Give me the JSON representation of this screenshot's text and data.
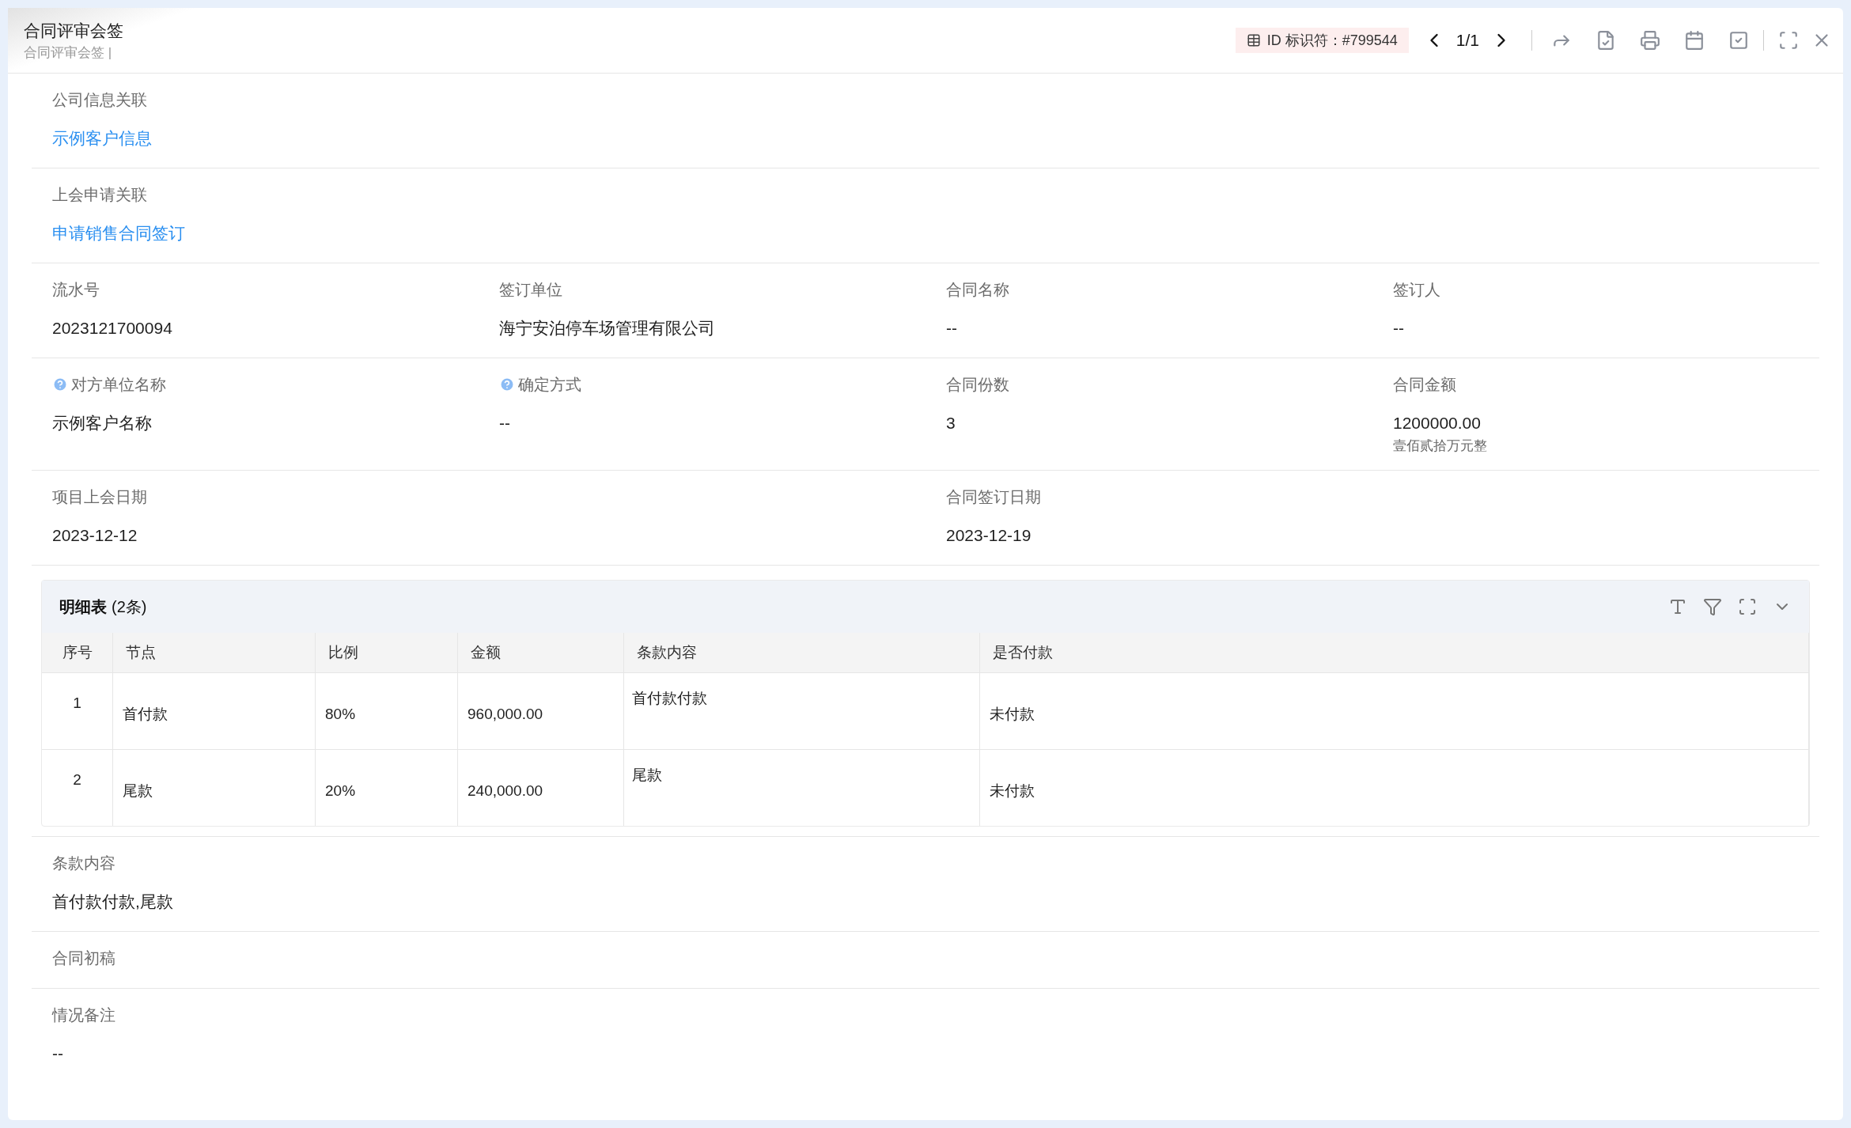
{
  "header": {
    "title": "合同评审会签",
    "subtitle": "合同评审会签 |",
    "id_badge": "ID 标识符：#799544",
    "pager": "1/1"
  },
  "rows": [
    {
      "fields": [
        {
          "label": "公司信息关联",
          "value": "示例客户信息",
          "link": true
        }
      ]
    },
    {
      "fields": [
        {
          "label": "上会申请关联",
          "value": "申请销售合同签订",
          "link": true
        }
      ]
    },
    {
      "fields": [
        {
          "label": "流水号",
          "value": "2023121700094"
        },
        {
          "label": "签订单位",
          "value": "海宁安泊停车场管理有限公司"
        },
        {
          "label": "合同名称",
          "value": "--"
        },
        {
          "label": "签订人",
          "value": "--"
        }
      ]
    },
    {
      "fields": [
        {
          "label": "对方单位名称",
          "value": "示例客户名称",
          "help": true
        },
        {
          "label": "确定方式",
          "value": "--",
          "help": true
        },
        {
          "label": "合同份数",
          "value": "3"
        },
        {
          "label": "合同金额",
          "value": "1200000.00",
          "note": "壹佰贰拾万元整"
        }
      ]
    },
    {
      "fields": [
        {
          "label": "项目上会日期",
          "value": "2023-12-12"
        },
        {
          "label": "合同签订日期",
          "value": "2023-12-19"
        }
      ]
    }
  ],
  "detail": {
    "title": "明细表",
    "count": "(2条)",
    "columns": [
      "序号",
      "节点",
      "比例",
      "金额",
      "条款内容",
      "是否付款"
    ],
    "rows": [
      [
        "1",
        "首付款",
        "80%",
        "960,000.00",
        "首付款付款",
        "未付款"
      ],
      [
        "2",
        "尾款",
        "20%",
        "240,000.00",
        "尾款",
        "未付款"
      ]
    ]
  },
  "bottom": [
    {
      "label": "条款内容",
      "value": "首付款付款,尾款"
    },
    {
      "label": "合同初稿"
    },
    {
      "label": "情况备注",
      "value": "--"
    }
  ]
}
